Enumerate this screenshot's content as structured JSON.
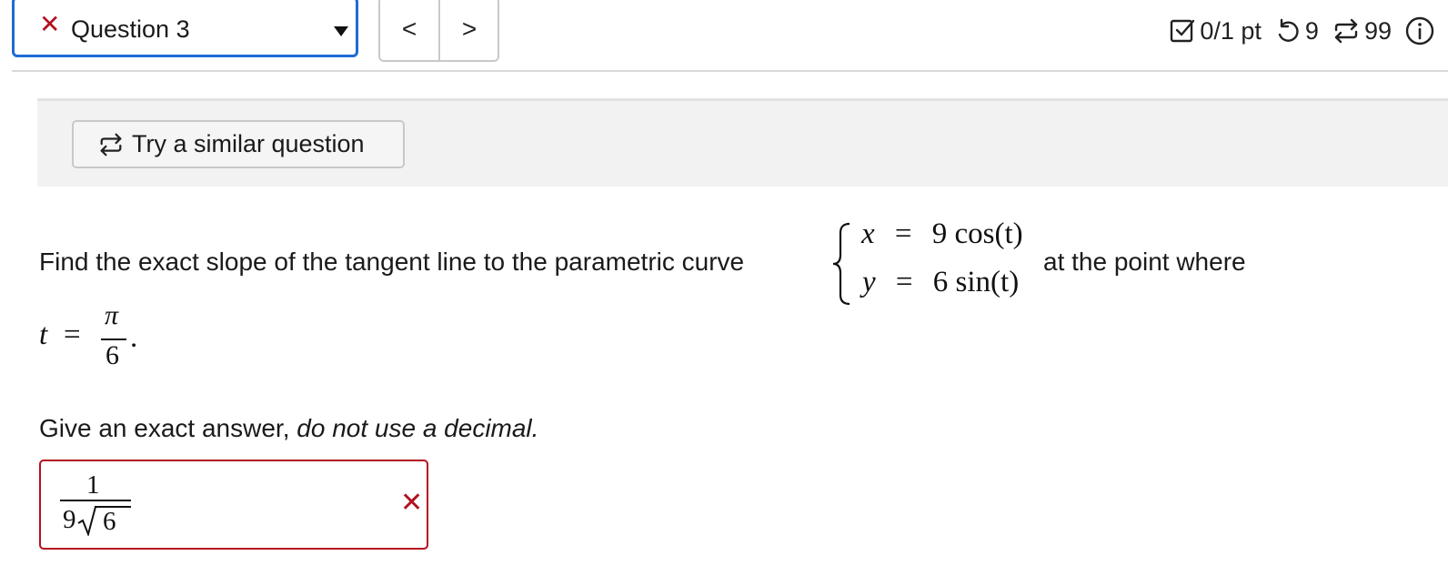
{
  "header": {
    "question_label": "Question 3",
    "question_status_icon": "x-icon",
    "prev_label": "<",
    "next_label": ">",
    "score": "0/1 pt",
    "retries": "9",
    "attempts": "99"
  },
  "panel": {
    "similar_label": "Try a similar question"
  },
  "question": {
    "prompt": "Find the exact slope of the tangent line to the parametric curve",
    "prompt_tail": "at the point where",
    "x_var": "x",
    "x_rhs": "9 cos(t)",
    "y_var": "y",
    "y_rhs": "6 sin(t)",
    "t_var": "t",
    "t_num": "π",
    "t_den": "6",
    "instruction_plain": "Give an exact answer, ",
    "instruction_italic": "do not use a decimal."
  },
  "answer": {
    "numerator": "1",
    "denominator_coef": "9",
    "denominator_radicand": "6",
    "status_icon": "wrong-icon"
  },
  "colors": {
    "accent_blue": "#1f6bd6",
    "error_red": "#b3101e",
    "panel_grey": "#f2f2f2"
  }
}
